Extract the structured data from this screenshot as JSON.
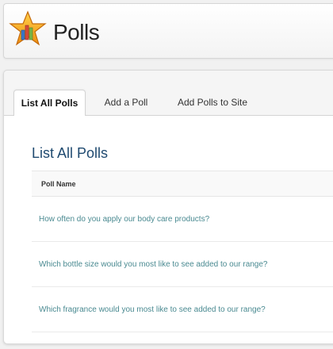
{
  "header": {
    "title": "Polls",
    "logo_icon": "polls-star-chart-icon"
  },
  "tabs": [
    {
      "label": "List All Polls",
      "active": true
    },
    {
      "label": "Add a Poll",
      "active": false
    },
    {
      "label": "Add Polls to Site",
      "active": false
    }
  ],
  "main": {
    "heading": "List All Polls",
    "table": {
      "columns": [
        "Poll Name"
      ],
      "rows": [
        "How often do you apply our body care products?",
        "Which bottle size would you most like to see added to our range?",
        "Which fragrance would you most like to see added to our range?"
      ]
    }
  },
  "colors": {
    "heading": "#1f4a70",
    "link": "#4a8a91",
    "star": "#f3a41c"
  }
}
